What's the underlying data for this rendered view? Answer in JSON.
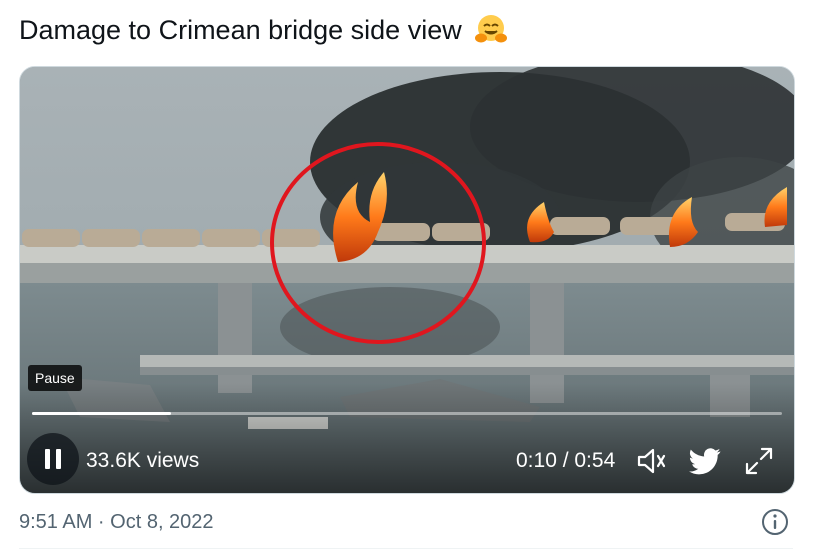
{
  "tweet": {
    "text": "Damage to Crimean bridge side view",
    "emoji": "hugging-face-emoji"
  },
  "video": {
    "tooltip": "Pause",
    "views": "33.6K views",
    "time": "0:10 / 0:54",
    "progress": 0.185,
    "icons": {
      "pause": "pause-icon",
      "volume": "volume-icon",
      "brand": "twitter-bird-icon",
      "fullscreen": "expand-icon"
    }
  },
  "footer": {
    "timestamp": "9:51 AM · Oct 8, 2022",
    "info_icon": "info-icon"
  },
  "colors": {
    "text": "#0f1419",
    "secondary": "#536471",
    "annotation_circle": "#e0161e",
    "fire": "#ff7a1a"
  }
}
